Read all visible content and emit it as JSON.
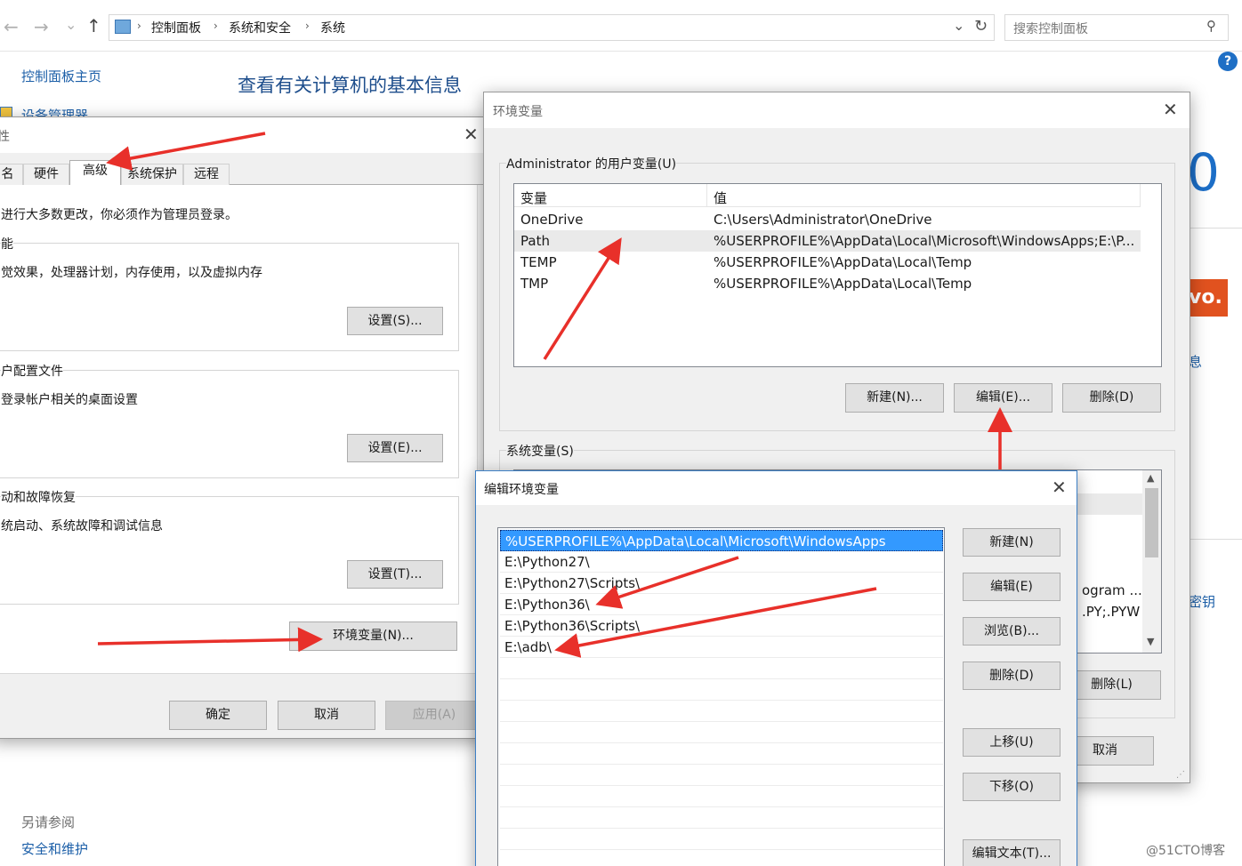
{
  "addressbar": {
    "back_icon": "←",
    "forward_icon": "→",
    "recent_icon": "⌄",
    "up_icon": "↑",
    "breadcrumbs": [
      "控制面板",
      "系统和安全",
      "系统"
    ],
    "search_placeholder": "搜索控制面板",
    "refresh_icon": "↻",
    "dropdown_icon": "⌄"
  },
  "cp_sidebar": {
    "home": "控制面板主页",
    "device_manager": "设备管理器",
    "see_also": "另请参阅",
    "security": "安全和维护"
  },
  "cp_main": {
    "title": "查看有关计算机的基本信息",
    "partial_title": "0",
    "partial_logo": "vo.",
    "partial_link1": "息",
    "partial_link2": "密钥",
    "help_icon": "?"
  },
  "sysprops": {
    "title_partial": "性",
    "tabs": [
      "名",
      "硬件",
      "高级",
      "系统保护",
      "远程"
    ],
    "admin_note": "进行大多数更改，你必须作为管理员登录。",
    "perf_legend": "能",
    "perf_desc": "觉效果，处理器计划，内存使用，以及虚拟内存",
    "perf_button": "设置(S)...",
    "profile_legend": "户配置文件",
    "profile_desc": "登录帐户相关的桌面设置",
    "profile_button": "设置(E)...",
    "startup_legend": "动和故障恢复",
    "startup_desc": "统启动、系统故障和调试信息",
    "startup_button": "设置(T)...",
    "env_button": "环境变量(N)...",
    "ok": "确定",
    "cancel": "取消",
    "apply": "应用(A)"
  },
  "envvars": {
    "title": "环境变量",
    "user_legend": "Administrator 的用户变量(U)",
    "col_var": "变量",
    "col_value": "值",
    "user_rows": [
      {
        "name": "OneDrive",
        "value": "C:\\Users\\Administrator\\OneDrive"
      },
      {
        "name": "Path",
        "value": "%USERPROFILE%\\AppData\\Local\\Microsoft\\WindowsApps;E:\\P..."
      },
      {
        "name": "TEMP",
        "value": "%USERPROFILE%\\AppData\\Local\\Temp"
      },
      {
        "name": "TMP",
        "value": "%USERPROFILE%\\AppData\\Local\\Temp"
      }
    ],
    "new_button": "新建(N)...",
    "edit_button": "编辑(E)...",
    "delete_button": "删除(D)",
    "sys_legend": "系统变量(S)",
    "sys_partial_1": "ogram ...",
    "sys_partial_2": ".PY;.PYW",
    "sys_delete_button": "删除(L)",
    "cancel": "取消"
  },
  "editenv": {
    "title": "编辑环境变量",
    "items": [
      "%USERPROFILE%\\AppData\\Local\\Microsoft\\WindowsApps",
      "E:\\Python27\\",
      "E:\\Python27\\Scripts\\",
      "E:\\Python36\\",
      "E:\\Python36\\Scripts\\",
      "E:\\adb\\"
    ],
    "new": "新建(N)",
    "edit": "编辑(E)",
    "browse": "浏览(B)...",
    "delete": "删除(D)",
    "move_up": "上移(U)",
    "move_down": "下移(O)",
    "edit_text": "编辑文本(T)..."
  },
  "watermark": "@51CTO博客",
  "colors": {
    "arrow": "#e8302a",
    "link_blue": "#1c5fa8",
    "selection": "#3399ff"
  }
}
